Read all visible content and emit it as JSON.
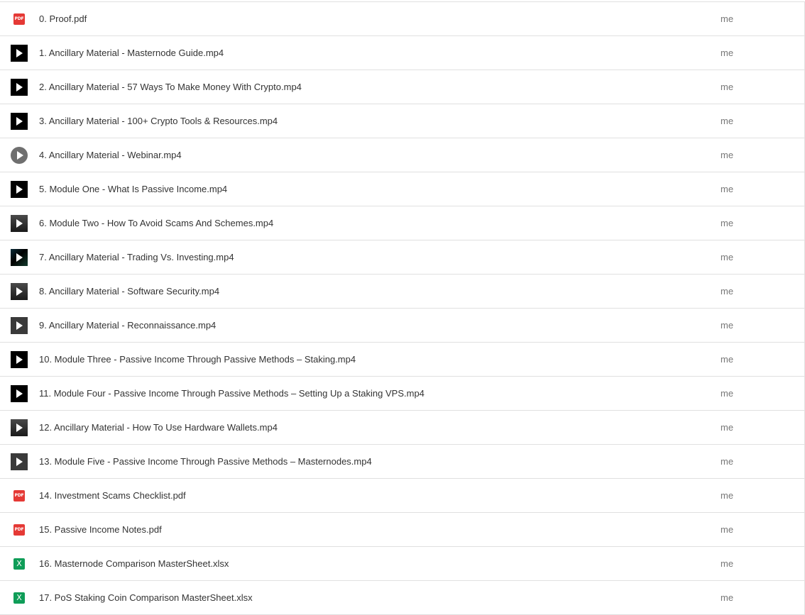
{
  "files": [
    {
      "name": "0. Proof.pdf",
      "owner": "me",
      "icon": "pdf-icon"
    },
    {
      "name": "1. Ancillary Material - Masternode Guide.mp4",
      "owner": "me",
      "icon": "video-icon"
    },
    {
      "name": "2. Ancillary Material - 57 Ways To Make Money With Crypto.mp4",
      "owner": "me",
      "icon": "video-icon"
    },
    {
      "name": "3. Ancillary Material - 100+ Crypto Tools & Resources.mp4",
      "owner": "me",
      "icon": "video-icon"
    },
    {
      "name": "4. Ancillary Material - Webinar.mp4",
      "owner": "me",
      "icon": "play-circle-icon"
    },
    {
      "name": "5. Module One - What Is Passive Income.mp4",
      "owner": "me",
      "icon": "video-icon"
    },
    {
      "name": "6. Module Two - How To Avoid Scams And Schemes.mp4",
      "owner": "me",
      "icon": "video-icon"
    },
    {
      "name": "7. Ancillary Material - Trading Vs. Investing.mp4",
      "owner": "me",
      "icon": "video-icon"
    },
    {
      "name": "8. Ancillary Material - Software Security.mp4",
      "owner": "me",
      "icon": "video-icon"
    },
    {
      "name": "9. Ancillary Material - Reconnaissance.mp4",
      "owner": "me",
      "icon": "video-icon"
    },
    {
      "name": "10. Module Three - Passive Income Through Passive Methods – Staking.mp4",
      "owner": "me",
      "icon": "video-icon"
    },
    {
      "name": "11. Module Four - Passive Income Through Passive Methods – Setting Up a Staking VPS.mp4",
      "owner": "me",
      "icon": "video-icon"
    },
    {
      "name": "12. Ancillary Material - How To Use Hardware Wallets.mp4",
      "owner": "me",
      "icon": "video-icon"
    },
    {
      "name": "13. Module Five - Passive Income Through Passive Methods – Masternodes.mp4",
      "owner": "me",
      "icon": "video-icon"
    },
    {
      "name": "14. Investment Scams Checklist.pdf",
      "owner": "me",
      "icon": "pdf-icon"
    },
    {
      "name": "15. Passive Income Notes.pdf",
      "owner": "me",
      "icon": "pdf-icon"
    },
    {
      "name": "16. Masternode Comparison MasterSheet.xlsx",
      "owner": "me",
      "icon": "spreadsheet-icon"
    },
    {
      "name": "17. PoS Staking Coin Comparison MasterSheet.xlsx",
      "owner": "me",
      "icon": "spreadsheet-icon"
    }
  ],
  "icon_labels": {
    "pdf": "PDF",
    "spreadsheet": "X"
  },
  "colors": {
    "pdf": "#e53935",
    "spreadsheet": "#0f9d58",
    "video": "#000000"
  }
}
